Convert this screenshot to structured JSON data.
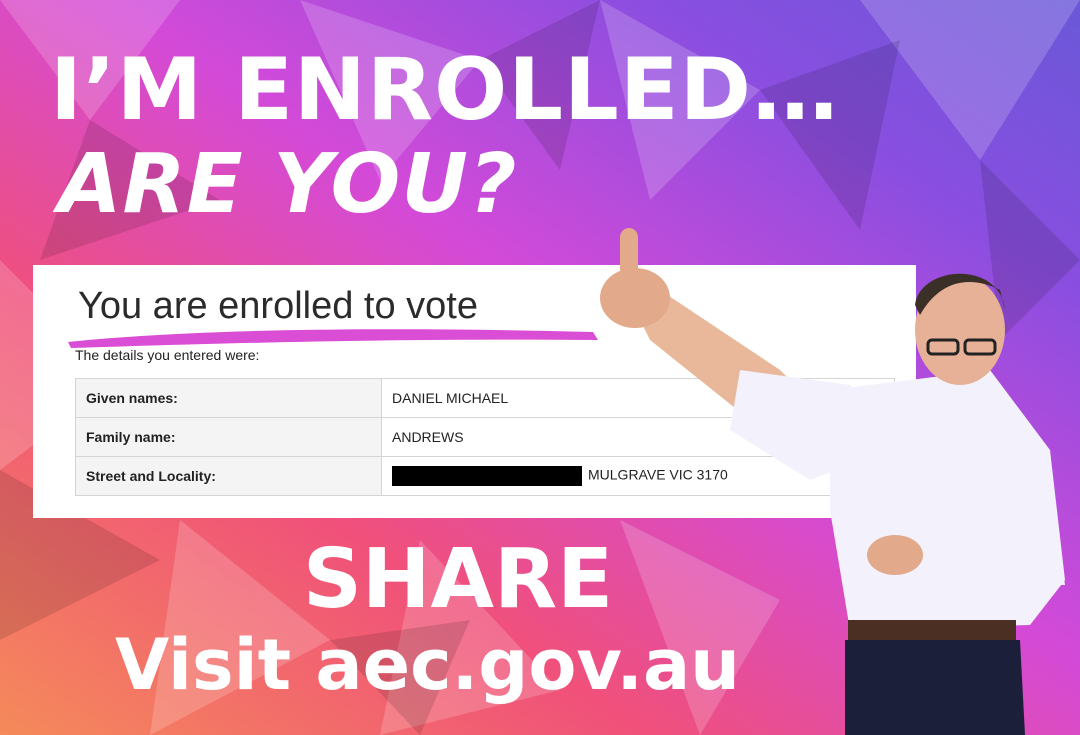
{
  "headline": {
    "line1": "I’M ENROLLED…",
    "line2": "ARE YOU?"
  },
  "card": {
    "title": "You are enrolled to vote",
    "subtitle": "The details you entered were:",
    "rows": [
      {
        "label": "Given names:",
        "value": "DANIEL MICHAEL"
      },
      {
        "label": "Family name:",
        "value": "ANDREWS"
      },
      {
        "label": "Street and Locality:",
        "value": "MULGRAVE VIC 3170"
      }
    ],
    "underline_color": "#d63ad0"
  },
  "cta": {
    "share": "SHARE",
    "visit": "Visit aec.gov.au"
  },
  "colors": {
    "bg_left": "#f05a6a",
    "bg_mid": "#d84ad8",
    "bg_right": "#7050e0",
    "shirt": "#f3f1fb",
    "trousers": "#1c1f3a"
  }
}
